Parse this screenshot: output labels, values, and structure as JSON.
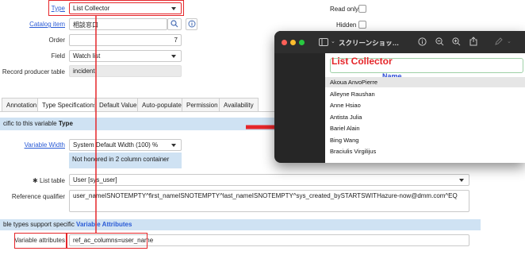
{
  "form": {
    "type_label": "Type",
    "type_value": "List Collector",
    "catalog_item_label": "Catalog item",
    "catalog_item_value": "相談窓口",
    "order_label": "Order",
    "order_value": "7",
    "field_label": "Field",
    "field_value": "Watch list",
    "record_producer_table_label": "Record producer table",
    "record_producer_table_value": "incident",
    "read_only_label": "Read only",
    "hidden_label": "Hidden"
  },
  "tabs": [
    {
      "label": "Annotation"
    },
    {
      "label": "Type Specifications"
    },
    {
      "label": "Default Value"
    },
    {
      "label": "Auto-populate"
    },
    {
      "label": "Permission"
    },
    {
      "label": "Availability"
    }
  ],
  "type_spec": {
    "banner_prefix": "cific to this variable ",
    "banner_bold": "Type",
    "variable_width_label": "Variable Width",
    "variable_width_value": "System Default Width (100) %",
    "variable_width_note": "Not honored in 2 column container",
    "list_table_required": "✱",
    "list_table_label": "List table",
    "list_table_value": "User [sys_user]",
    "reference_qualifier_label": "Reference qualifier",
    "reference_qualifier_value": "user_nameISNOTEMPTY^first_nameISNOTEMPTY^last_nameISNOTEMPTY^sys_created_bySTARTSWITHazure-now@dmm.com^EQ",
    "attributes_banner_prefix": "ble types support specific ",
    "attributes_banner_link": "Variable Attributes",
    "variable_attributes_label": "Variable attributes",
    "variable_attributes_value": "ref_ac_columns=user_name"
  },
  "preview_window": {
    "title": "スクリーンショッ…",
    "heading": "List Collector",
    "column_header": "Name",
    "names": [
      "Akoua AnvoPierre",
      "Alleyne Raushan",
      "Anne Hsiao",
      "Antista Julia",
      "Bariel Alain",
      "Bing Wang",
      "Braciulis Virgilijus"
    ]
  },
  "icons": [
    "search-icon",
    "info-icon",
    "sidebar-icon",
    "zoom-out-icon",
    "zoom-in-icon",
    "share-icon",
    "pen-icon",
    "chevron-down-icon"
  ],
  "colors": {
    "accent_red": "#e5262a",
    "link_blue": "#2a5bd6",
    "banner_blue": "#cfe2f3",
    "window_bg": "#262626"
  }
}
